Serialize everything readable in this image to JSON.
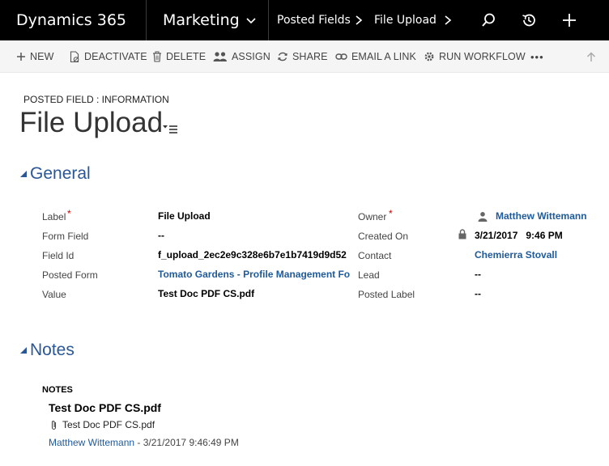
{
  "nav": {
    "brand": "Dynamics 365",
    "area": "Marketing",
    "breadcrumb": [
      "Posted Fields",
      "File Upload"
    ]
  },
  "commands": {
    "new": "NEW",
    "deactivate": "DEACTIVATE",
    "delete": "DELETE",
    "assign": "ASSIGN",
    "share": "SHARE",
    "email_link": "EMAIL A LINK",
    "run_workflow": "RUN WORKFLOW",
    "more": "•••"
  },
  "header": {
    "entity_label": "POSTED FIELD : INFORMATION",
    "title": "File Upload"
  },
  "sections": {
    "general": "General",
    "notes": "Notes"
  },
  "fields_left": [
    {
      "label": "Label",
      "required": true,
      "value": "File Upload"
    },
    {
      "label": "Form Field",
      "value": "--"
    },
    {
      "label": "Field Id",
      "value": "f_upload_2ec2e9c328e6b7e1b7419d9d52"
    },
    {
      "label": "Posted Form",
      "value": "Tomato Gardens - Profile Management Fo"
    },
    {
      "label": "Value",
      "value": "Test Doc PDF CS.pdf"
    }
  ],
  "fields_right": [
    {
      "label": "Owner",
      "required": true,
      "value": "Matthew Wittemann"
    },
    {
      "label": "Created On",
      "value": "3/21/2017   9:46 PM"
    },
    {
      "label": "Contact",
      "value": "Chemierra Stovall"
    },
    {
      "label": "Lead",
      "value": "--"
    },
    {
      "label": "Posted Label",
      "value": "--"
    }
  ],
  "notes": {
    "heading": "NOTES",
    "title": "Test Doc PDF CS.pdf",
    "attachment": "Test Doc PDF CS.pdf",
    "author": "Matthew Wittemann",
    "separator": " - ",
    "timestamp": "3/21/2017 9:46:49 PM"
  },
  "colors": {
    "nav_bg": "#000000",
    "link": "#1f5a9b",
    "section": "#2b5797",
    "required": "#cc0000"
  }
}
